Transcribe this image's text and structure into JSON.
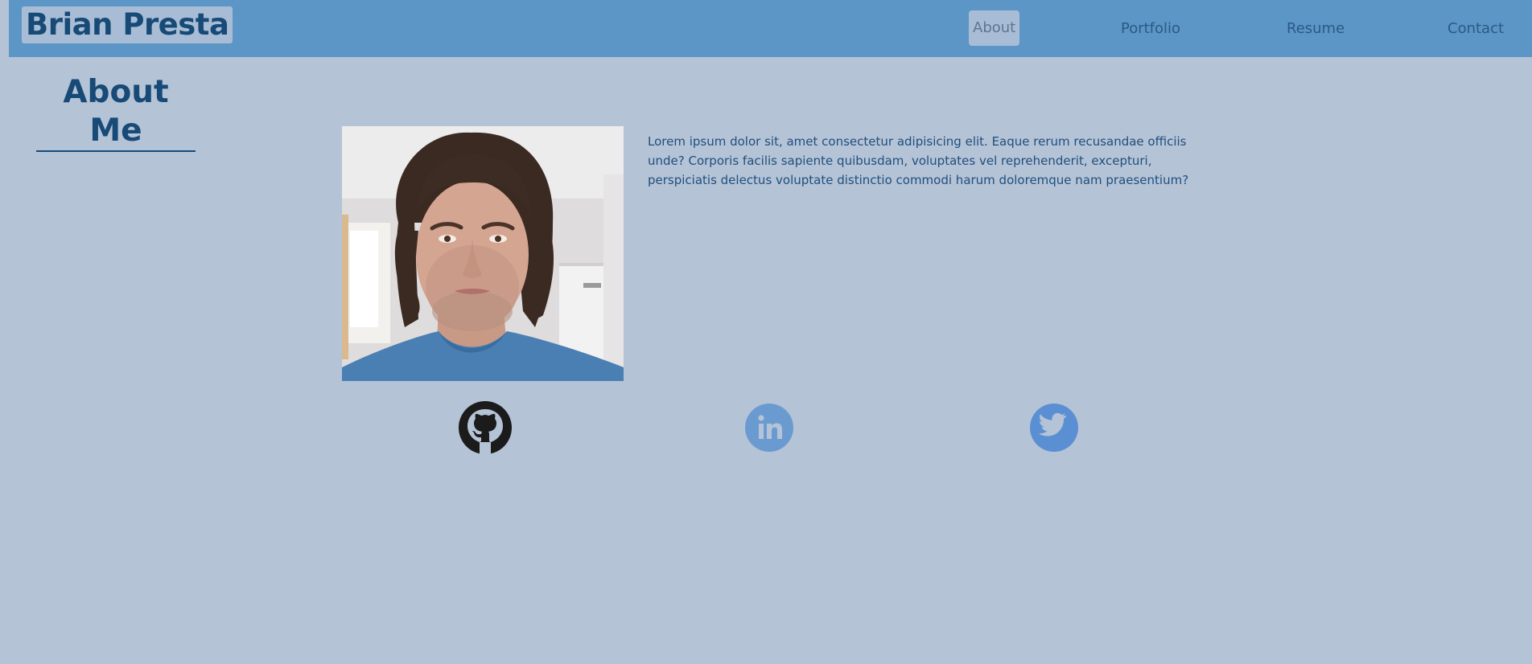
{
  "header": {
    "brand": "Brian Presta",
    "nav": [
      {
        "label": "About",
        "active": true
      },
      {
        "label": "Portfolio",
        "active": false
      },
      {
        "label": "Resume",
        "active": false
      },
      {
        "label": "Contact",
        "active": false
      }
    ]
  },
  "about": {
    "title": "About Me",
    "bio": "Lorem ipsum dolor sit, amet consectetur adipisicing elit. Eaque rerum recusandae officiis unde? Corporis facilis sapiente quibusdam, voluptates vel reprehenderit, excepturi, perspiciatis delectus voluptate distinctio commodi harum doloremque nam praesentium?"
  },
  "social": [
    {
      "icon": "github-icon",
      "color": "#1b1b1b"
    },
    {
      "icon": "linkedin-icon",
      "color": "#6a9bd0"
    },
    {
      "icon": "twitter-icon",
      "color": "#5b8fd3"
    }
  ],
  "colors": {
    "page_bg": "#b5c3d6",
    "header_bg": "#5b96c6",
    "brand_text": "#174a77",
    "nav_active_bg": "#a8bdd5"
  }
}
